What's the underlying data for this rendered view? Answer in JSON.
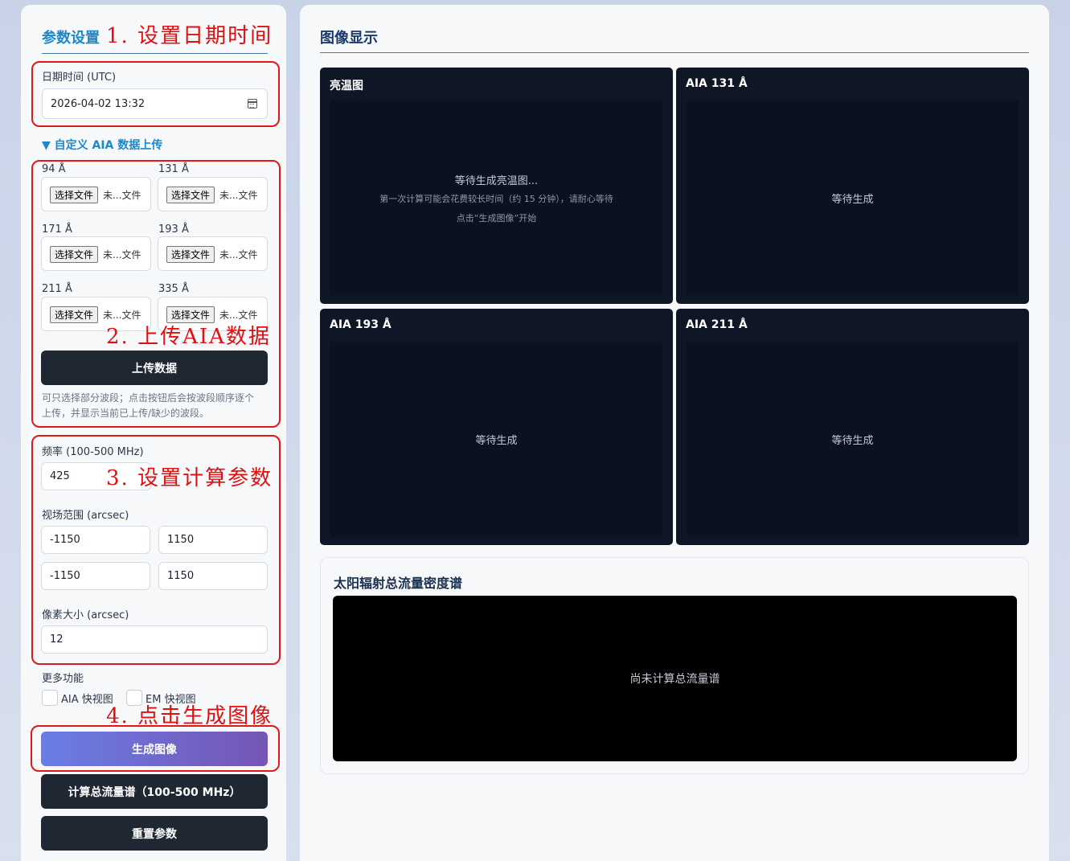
{
  "left": {
    "title": "参数设置",
    "datetime_label": "日期时间 (UTC)",
    "datetime_value": "2026-04-02 13:32",
    "custom_toggle": "▼ 自定义 AIA 数据上传",
    "uploads": [
      {
        "label": "94 Å",
        "button": "选择文件",
        "status": "未...文件"
      },
      {
        "label": "131 Å",
        "button": "选择文件",
        "status": "未...文件"
      },
      {
        "label": "171 Å",
        "button": "选择文件",
        "status": "未...文件"
      },
      {
        "label": "193 Å",
        "button": "选择文件",
        "status": "未...文件"
      },
      {
        "label": "211 Å",
        "button": "选择文件",
        "status": "未...文件"
      },
      {
        "label": "335 Å",
        "button": "选择文件",
        "status": "未...文件"
      }
    ],
    "upload_button": "上传数据",
    "upload_hint_1": "可只选择部分波段；点击按钮后会按波段顺序逐个",
    "upload_hint_2": "上传，并显示当前已上传/缺少的波段。",
    "freq_label": "频率 (100-500 MHz)",
    "freq_value": "425",
    "fov_label": "视场范围 (arcsec)",
    "fov": {
      "x_min": "-1150",
      "x_max": "1150",
      "y_min": "-1150",
      "y_max": "1150"
    },
    "pixel_label": "像素大小 (arcsec)",
    "pixel_value": "12",
    "more_label": "更多功能",
    "check_aia": "AIA 快视图",
    "check_em": "EM 快视图",
    "generate_button": "生成图像",
    "spectrum_button": "计算总流量谱（100-500 MHz）",
    "reset_button": "重置参数"
  },
  "annotations": {
    "step1": "1. 设置日期时间",
    "step2": "2. 上传AIA数据",
    "step3": "3. 设置计算参数",
    "step4": "4. 点击生成图像"
  },
  "right": {
    "title": "图像显示",
    "cards": [
      {
        "title": "亮温图",
        "msg": "等待生成亮温图...",
        "sub1": "第一次计算可能会花费较长时间（约 15 分钟），请耐心等待",
        "sub2": "点击“生成图像”开始"
      },
      {
        "title": "AIA 131 Å",
        "msg": "等待生成"
      },
      {
        "title": "AIA 193 Å",
        "msg": "等待生成"
      },
      {
        "title": "AIA 211 Å",
        "msg": "等待生成"
      }
    ],
    "spectrum_title": "太阳辐射总流量密度谱",
    "spectrum_msg": "尚未计算总流量谱"
  },
  "colors": {
    "accent": "#1e88c7",
    "annotation": "#e01010",
    "dark_button": "#1f2733",
    "image_bg": "#0f1626"
  }
}
